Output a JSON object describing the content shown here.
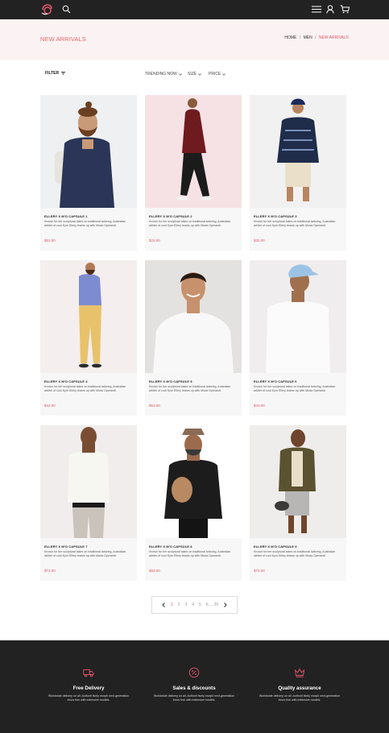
{
  "colors": {
    "accent": "#e4546a",
    "dark": "#222222",
    "header_bg": "#fbf2f3"
  },
  "nav": {
    "logo_icon": "logo-icon",
    "search_icon": "search-icon",
    "menu_icon": "hamburger-menu-icon",
    "user_icon": "user-icon",
    "cart_icon": "cart-icon"
  },
  "header": {
    "title": "NEW ARRIVALS",
    "breadcrumb": {
      "home": "HOME",
      "sep1": "/",
      "men": "MEN",
      "sep2": "/",
      "current": "NEW ARRIVALS"
    }
  },
  "toolbar": {
    "filter": "FILTER",
    "trending": "TRENDING NOW",
    "size": "SIZE",
    "price": "PRICE"
  },
  "products": [
    {
      "name": "ELLERY X M'O CAPSULE 1",
      "desc": "Known for her sculptural takes on traditional tailoring, Australian arbiter of cool Kym Ellery teams up with Moda Operandi.",
      "price": "$52.00"
    },
    {
      "name": "ELLERY X M'O CAPSULE 2",
      "desc": "Known for her sculptural takes on traditional tailoring, Australian arbiter of cool Kym Ellery teams up with Moda Operandi.",
      "price": "$22.00"
    },
    {
      "name": "ELLERY X M'O CAPSULE 3",
      "desc": "Known for her sculptural takes on traditional tailoring, Australian arbiter of cool Kym Ellery teams up with Moda Operandi.",
      "price": "$32.00"
    },
    {
      "name": "ELLERY X M'O CAPSULE 4",
      "desc": "Known for her sculptural takes on traditional tailoring, Australian arbiter of cool Kym Ellery teams up with Moda Operandi.",
      "price": "$42.00"
    },
    {
      "name": "ELLERY X M'O CAPSULE 5",
      "desc": "Known for her sculptural takes on traditional tailoring, Australian arbiter of cool Kym Ellery teams up with Moda Operandi.",
      "price": "$51.00"
    },
    {
      "name": "ELLERY X M'O CAPSULE 6",
      "desc": "Known for her sculptural takes on traditional tailoring, Australian arbiter of cool Kym Ellery teams up with Moda Operandi.",
      "price": "$43.00"
    },
    {
      "name": "ELLERY X M'O CAPSULE 7",
      "desc": "Known for her sculptural takes on traditional tailoring, Australian arbiter of cool Kym Ellery teams up with Moda Operandi.",
      "price": "$72.00"
    },
    {
      "name": "ELLERY X M'O CAPSULE 8",
      "desc": "Known for her sculptural takes on traditional tailoring, Australian arbiter of cool Kym Ellery teams up with Moda Operandi.",
      "price": "$82.00"
    },
    {
      "name": "ELLERY X M'O CAPSULE 9",
      "desc": "Known for her sculptural takes on traditional tailoring, Australian arbiter of cool Kym Ellery teams up with Moda Operandi.",
      "price": "$72.00"
    }
  ],
  "pagination": {
    "prev_icon": "chevron-left-icon",
    "next_icon": "chevron-right-icon",
    "pages": [
      "1",
      "2",
      "3",
      "4",
      "5",
      "6.....25"
    ]
  },
  "features": [
    {
      "icon": "truck-icon",
      "title": "Free Delivery",
      "text": "Worldwide delivery on all. Authorit tively morph next-generation innov tion with extensive models."
    },
    {
      "icon": "discount-badge-icon",
      "title": "Sales & discounts",
      "text": "Worldwide delivery on all. Authorit tively morph next-generation innov tion with extensive models."
    },
    {
      "icon": "crown-icon",
      "title": "Quality assurance",
      "text": "Worldwide delivery on all. Authorit tively morph next-generation innov tion with extensive models."
    }
  ]
}
